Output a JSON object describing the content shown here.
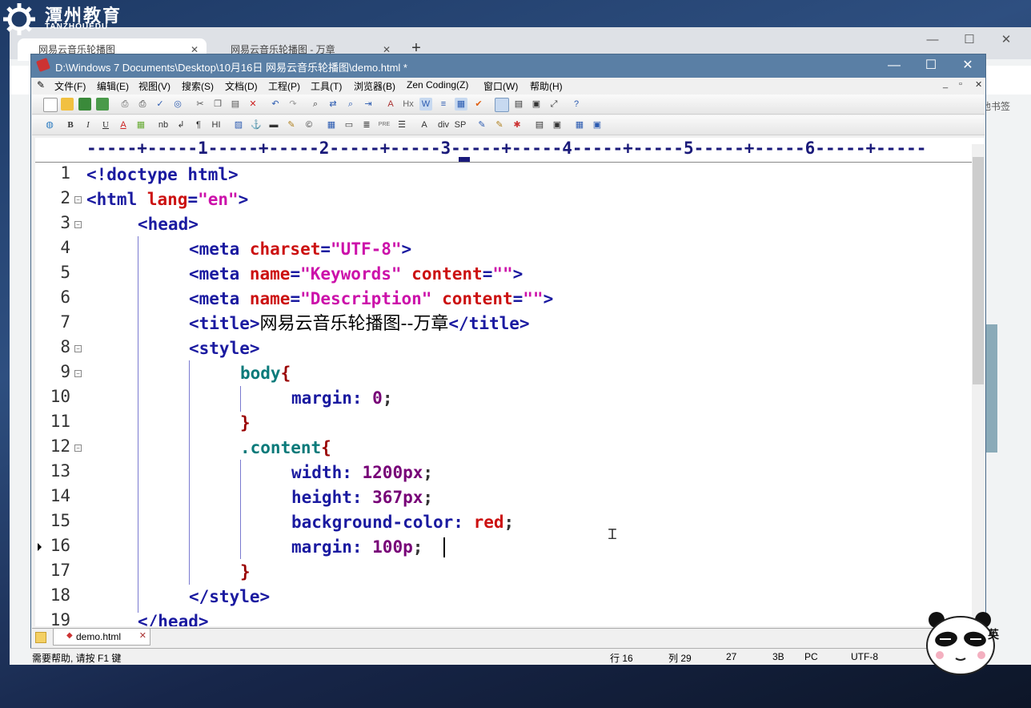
{
  "watermark": {
    "cn": "潭州教育",
    "en": "TANZHOUEDU"
  },
  "browser": {
    "tabs": [
      {
        "label": "网易云音乐轮播图"
      },
      {
        "label": "网易云音乐轮播图 - 万章"
      }
    ],
    "new_tab": "+",
    "bookmarks_label": "他书签",
    "controls": {
      "minimize": "—",
      "maximize": "☐",
      "close": "✕"
    }
  },
  "editor": {
    "title": "D:\\Windows 7 Documents\\Desktop\\10月16日 网易云音乐轮播图\\demo.html *",
    "window_controls": {
      "minimize": "—",
      "maximize": "☐",
      "close": "✕"
    },
    "mdi_controls": {
      "minimize": "_",
      "restore": "▫",
      "close": "✕"
    },
    "menu": [
      "文件(F)",
      "编辑(E)",
      "视图(V)",
      "搜索(S)",
      "文档(D)",
      "工程(P)",
      "工具(T)",
      "浏览器(B)",
      "Zen Coding(Z)",
      "窗口(W)",
      "帮助(H)"
    ],
    "toolbar2_text": {
      "nb": "nb",
      "pre": "PRE",
      "div": "div",
      "sp": "SP",
      "b": "B",
      "i": "I",
      "u": "U",
      "a": "A",
      "hi": "HI"
    },
    "ruler": "-----+-----1-----+-----2-----+-----3-----+-----4-----+-----5-----+-----6-----+-----",
    "line_numbers": [
      "1",
      "2",
      "3",
      "4",
      "5",
      "6",
      "7",
      "8",
      "9",
      "10",
      "11",
      "12",
      "13",
      "14",
      "15",
      "16",
      "17",
      "18",
      "19"
    ],
    "code": {
      "l1": "<!doctype html>",
      "l2_tag": "<html ",
      "l2_attr": "lang",
      "l2_eq": "=",
      "l2_val": "\"en\"",
      "l2_end": ">",
      "l3": "<head>",
      "l4_tag": "<meta ",
      "l4_attr": "charset",
      "l4_eq": "=",
      "l4_val": "\"UTF-8\"",
      "l4_end": ">",
      "l5_tag": "<meta ",
      "l5_attr1": "name",
      "l5_eq1": "=",
      "l5_val1": "\"Keywords\"",
      "l5_attr2": " content",
      "l5_eq2": "=",
      "l5_val2": "\"\"",
      "l5_end": ">",
      "l6_tag": "<meta ",
      "l6_attr1": "name",
      "l6_eq1": "=",
      "l6_val1": "\"Description\"",
      "l6_attr2": " content",
      "l6_eq2": "=",
      "l6_val2": "\"\"",
      "l6_end": ">",
      "l7_open": "<title>",
      "l7_text": "网易云音乐轮播图--万章",
      "l7_close": "</title>",
      "l8": "<style>",
      "l9_sel": "body",
      "l9_br": "{",
      "l10_prop": "margin: ",
      "l10_val": "0",
      "l10_semi": ";",
      "l11": "}",
      "l12_sel": ".content",
      "l12_br": "{",
      "l13_prop": "width: ",
      "l13_val": "1200px",
      "l13_semi": ";",
      "l14_prop": "height: ",
      "l14_val": "367px",
      "l14_semi": ";",
      "l15_prop": "background-color: ",
      "l15_val": "red",
      "l15_semi": ";",
      "l16_prop": "margin: ",
      "l16_val": "100p",
      "l16_semi": ";",
      "l17": "}",
      "l18": "</style>",
      "l19": "</head>"
    },
    "file_tab": "demo.html",
    "status": {
      "help": "需要帮助, 请按 F1 键",
      "line": "行 16",
      "col": "列 29",
      "pos": "27",
      "size": "3B",
      "eol": "PC",
      "encoding": "UTF-8"
    }
  },
  "ime": {
    "label": "英"
  }
}
